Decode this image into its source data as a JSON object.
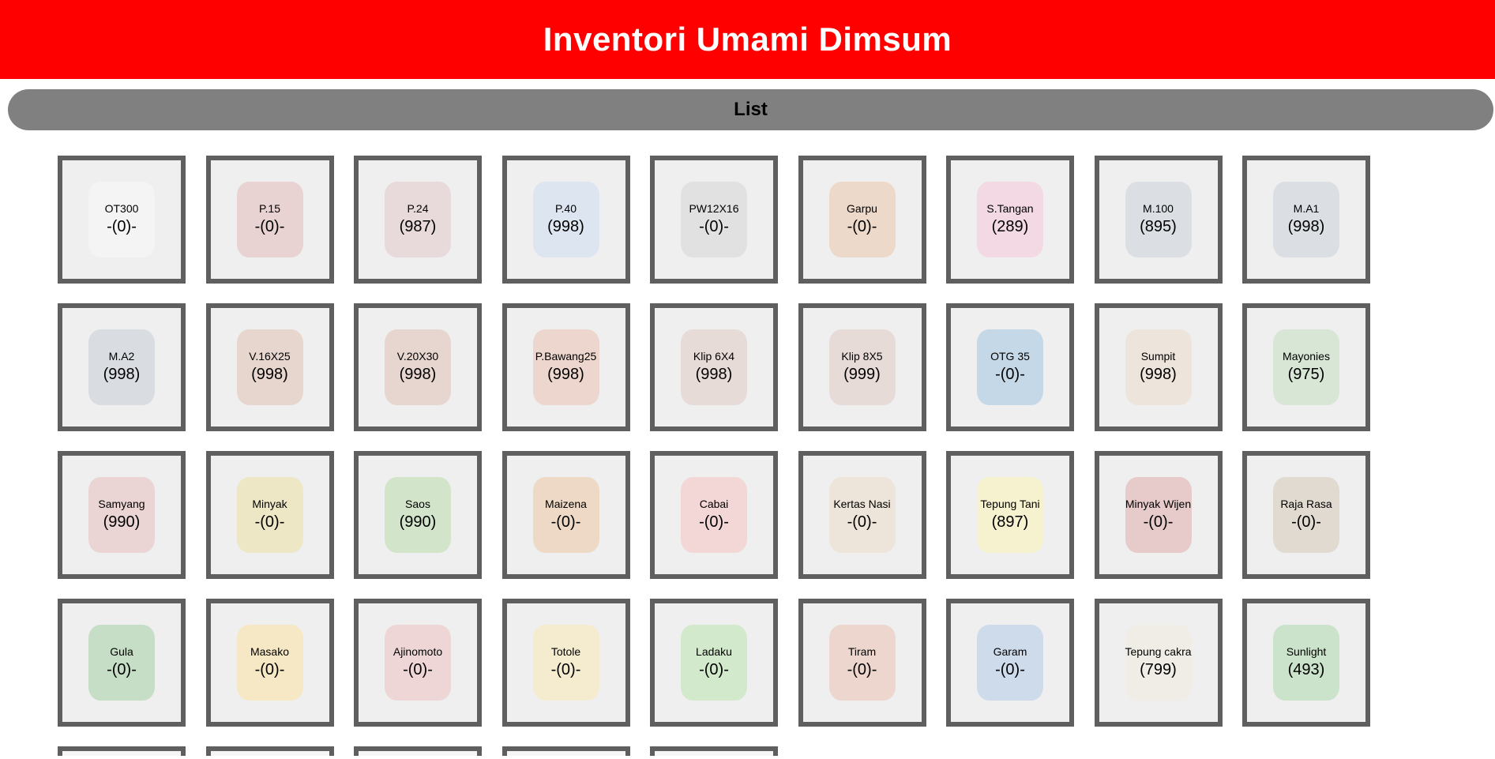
{
  "header": {
    "title": "Inventori Umami Dimsum"
  },
  "list_bar": {
    "label": "List"
  },
  "items": [
    {
      "name": "OT300",
      "qty": "-(0)-",
      "color": "#e8e8e8"
    },
    {
      "name": "P.15",
      "qty": "-(0)-",
      "color": "#c98f8f"
    },
    {
      "name": "P.24",
      "qty": "(987)",
      "color": "#c9a5a8"
    },
    {
      "name": "P.40",
      "qty": "(998)",
      "color": "#a9c2dd"
    },
    {
      "name": "PW12X16",
      "qty": "-(0)-",
      "color": "#b7b7b7"
    },
    {
      "name": "Garpu",
      "qty": "-(0)-",
      "color": "#d5a27a"
    },
    {
      "name": "S.Tangan",
      "qty": "(289)",
      "color": "#e3a2c0"
    },
    {
      "name": "M.100",
      "qty": "(895)",
      "color": "#a8b2bd"
    },
    {
      "name": "M.A1",
      "qty": "(998)",
      "color": "#a8b2bd"
    },
    {
      "name": "M.A2",
      "qty": "(998)",
      "color": "#a2acb8"
    },
    {
      "name": "V.16X25",
      "qty": "(998)",
      "color": "#c69a86"
    },
    {
      "name": "V.20X30",
      "qty": "(998)",
      "color": "#c39a88"
    },
    {
      "name": "P.Bawang25",
      "qty": "(998)",
      "color": "#d69a82"
    },
    {
      "name": "Klip 6X4",
      "qty": "(998)",
      "color": "#c7a7a0"
    },
    {
      "name": "Klip 8X5",
      "qty": "(999)",
      "color": "#c7a7a0"
    },
    {
      "name": "OTG 35",
      "qty": "-(0)-",
      "color": "#6f9fc6"
    },
    {
      "name": "Sumpit",
      "qty": "(998)",
      "color": "#d7c0a8"
    },
    {
      "name": "Mayonies",
      "qty": "(975)",
      "color": "#9fc49b"
    },
    {
      "name": "Samyang",
      "qty": "(990)",
      "color": "#cf9595"
    },
    {
      "name": "Minyak",
      "qty": "-(0)-",
      "color": "#d8c56f"
    },
    {
      "name": "Saos",
      "qty": "(990)",
      "color": "#8fbf7a"
    },
    {
      "name": "Maizena",
      "qty": "-(0)-",
      "color": "#d7a26e"
    },
    {
      "name": "Cabai",
      "qty": "-(0)-",
      "color": "#e59a9a"
    },
    {
      "name": "Kertas Nasi",
      "qty": "-(0)-",
      "color": "#d8c2a4"
    },
    {
      "name": "Tepung Tani",
      "qty": "(897)",
      "color": "#efe08a"
    },
    {
      "name": "Minyak Wijen",
      "qty": "-(0)-",
      "color": "#c87a7a"
    },
    {
      "name": "Raja Rasa",
      "qty": "-(0)-",
      "color": "#b7a58b"
    },
    {
      "name": "Gula",
      "qty": "-(0)-",
      "color": "#6fae6f"
    },
    {
      "name": "Masako",
      "qty": "-(0)-",
      "color": "#f0c96f"
    },
    {
      "name": "Ajinomoto",
      "qty": "-(0)-",
      "color": "#d89a9a"
    },
    {
      "name": "Totole",
      "qty": "-(0)-",
      "color": "#ead089"
    },
    {
      "name": "Ladaku",
      "qty": "-(0)-",
      "color": "#8fcf7f"
    },
    {
      "name": "Tiram",
      "qty": "-(0)-",
      "color": "#d59a86"
    },
    {
      "name": "Garam",
      "qty": "-(0)-",
      "color": "#86a8cf"
    },
    {
      "name": "Tepung cakra",
      "qty": "(799)",
      "color": "#dcd6c4"
    },
    {
      "name": "Sunlight",
      "qty": "(493)",
      "color": "#7fb87f"
    }
  ]
}
